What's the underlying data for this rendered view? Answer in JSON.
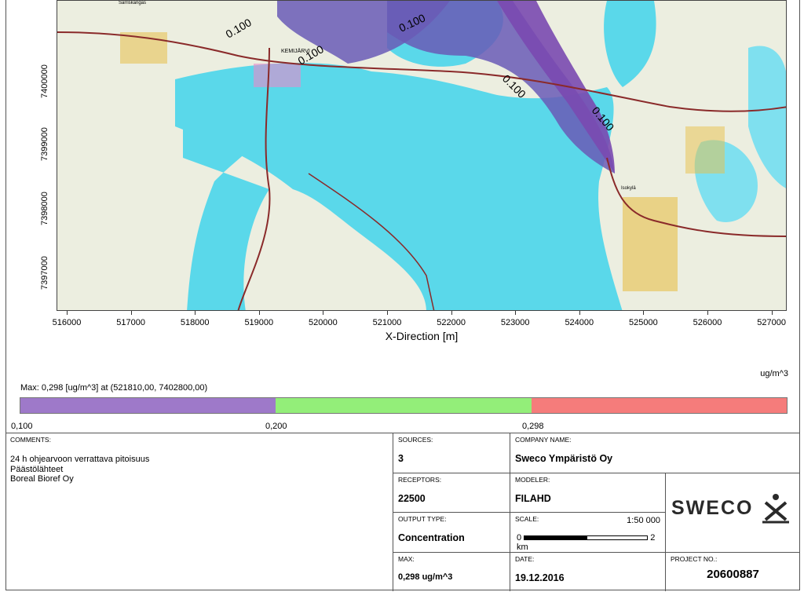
{
  "axes": {
    "xlabel": "X-Direction [m]",
    "xticks": [
      "516000",
      "517000",
      "518000",
      "519000",
      "520000",
      "521000",
      "522000",
      "523000",
      "524000",
      "525000",
      "526000",
      "527000"
    ],
    "yticks": [
      "7400000",
      "7399000",
      "7398000",
      "7397000"
    ]
  },
  "map": {
    "contour_labels": [
      "0.100",
      "0.100",
      "0.100",
      "0.100",
      "0.100"
    ],
    "place_labels": [
      "KEMIJÄRVI",
      "Isokylä",
      "Sarriskangas"
    ],
    "colors": {
      "water": "#5ad8ea",
      "land": "#eceee0",
      "plume": "#6a5ab6",
      "plume_core": "#7a49b0",
      "road": "#8a2a2a",
      "urban": "#e8c04a"
    }
  },
  "legend": {
    "units": "ug/m^3",
    "max_text": "Max:  0,298  [ug/m^3]  at  (521810,00, 7402800,00)",
    "ticks": [
      "0,100",
      "0,200",
      "0,298"
    ],
    "colors": [
      "#9e79c9",
      "#93ee79",
      "#f57c7b"
    ]
  },
  "info": {
    "comments_caption": "COMMENTS:",
    "comments": [
      "24 h ohjearvoon verrattava pitoisuus",
      "Päästölähteet",
      "Boreal Bioref Oy"
    ],
    "sources_caption": "SOURCES:",
    "sources": "3",
    "company_caption": "COMPANY NAME:",
    "company": "Sweco Ympäristö Oy",
    "receptors_caption": "RECEPTORS:",
    "receptors": "22500",
    "modeler_caption": "MODELER:",
    "modeler": "FILAHD",
    "output_caption": "OUTPUT TYPE:",
    "output": "Concentration",
    "scale_caption": "SCALE:",
    "scale_ratio": "1:50 000",
    "scale_left": "0",
    "scale_right": "2 km",
    "max_caption": "MAX:",
    "max": "0,298 ug/m^3",
    "date_caption": "DATE:",
    "date": "19.12.2016",
    "project_caption": "PROJECT NO.:",
    "project": "20600887",
    "logo_text": "SWECO"
  }
}
